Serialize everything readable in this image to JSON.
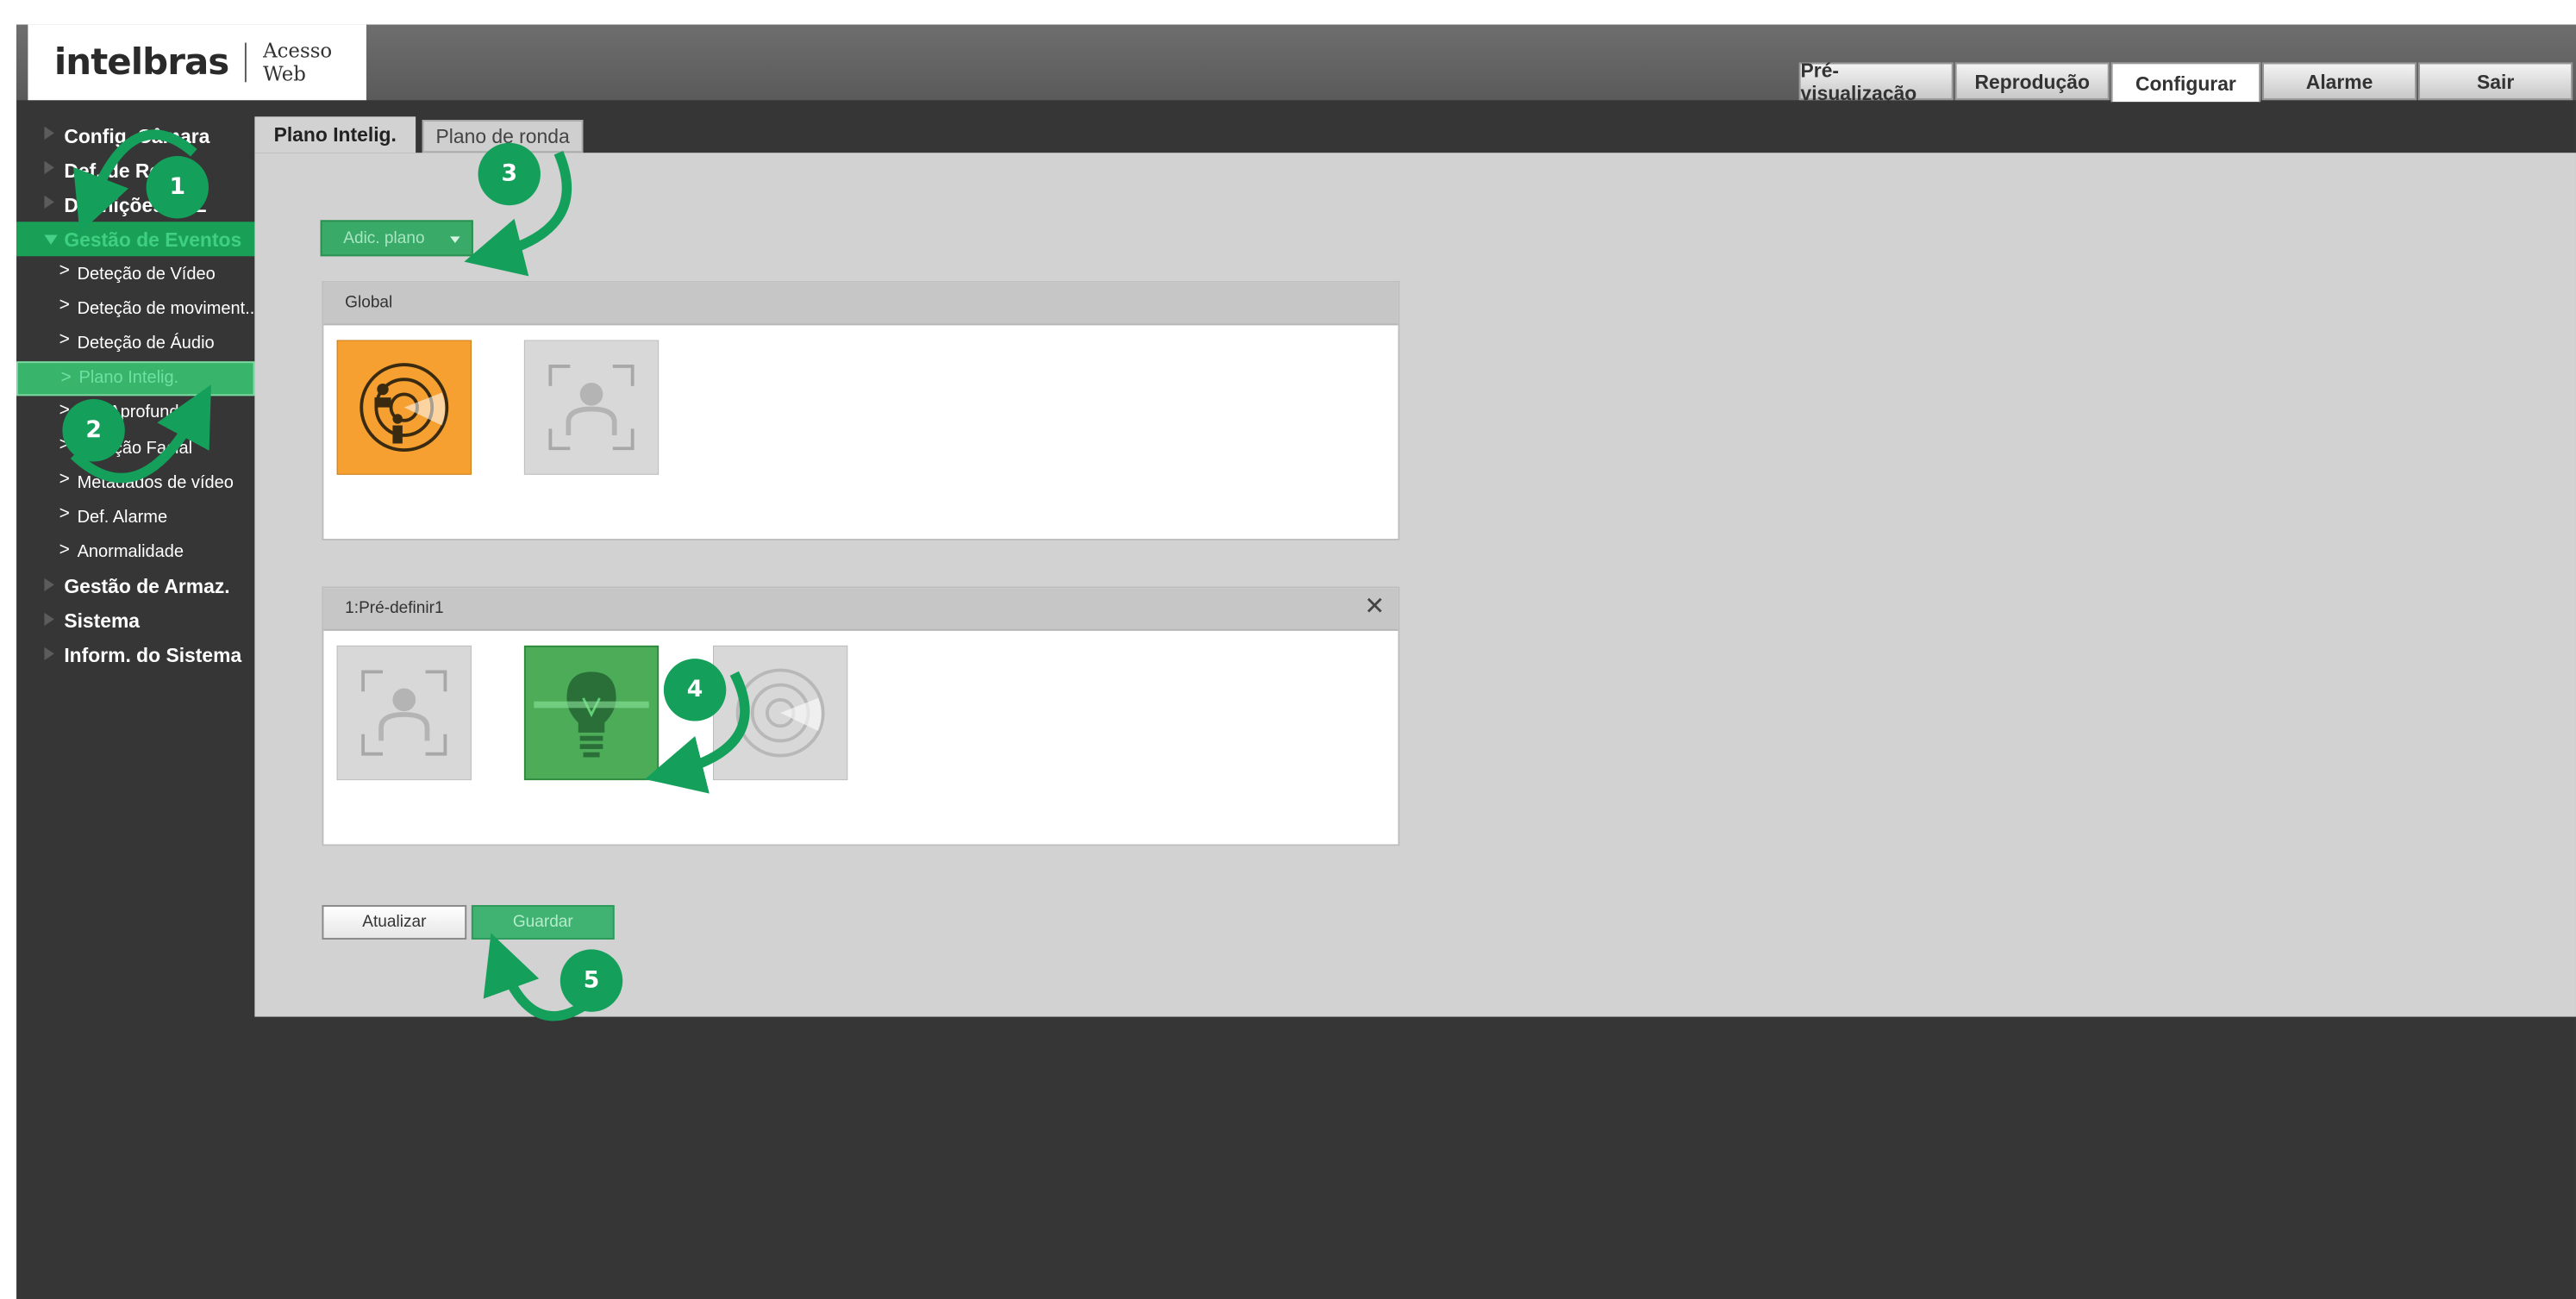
{
  "header": {
    "brand": "intelbras",
    "subtitle": "Acesso Web",
    "nav": [
      {
        "label": "Pré-visualização",
        "active": false
      },
      {
        "label": "Reprodução",
        "active": false
      },
      {
        "label": "Configurar",
        "active": true
      },
      {
        "label": "Alarme",
        "active": false
      },
      {
        "label": "Sair",
        "active": false
      }
    ]
  },
  "sidebar": {
    "sections": [
      {
        "label": "Config. Câmara"
      },
      {
        "label": "Def. de Rede"
      },
      {
        "label": "Definições PTZ"
      },
      {
        "label": "Gestão de Eventos",
        "open": true
      },
      {
        "label": "Gestão de Armaz."
      },
      {
        "label": "Sistema"
      },
      {
        "label": "Inform. do Sistema"
      }
    ],
    "event_items": [
      {
        "label": "Deteção de Vídeo"
      },
      {
        "label": "Deteção de moviment..."
      },
      {
        "label": "Deteção de Áudio"
      },
      {
        "label": "Plano Intelig.",
        "active": true
      },
      {
        "label": "IVS Aprofundado"
      },
      {
        "label": "Deteção Facial"
      },
      {
        "label": "Metadados de vídeo"
      },
      {
        "label": "Def. Alarme"
      },
      {
        "label": "Anormalidade"
      }
    ]
  },
  "tabs": [
    {
      "label": "Plano Intelig.",
      "active": true
    },
    {
      "label": "Plano de ronda",
      "active": false
    }
  ],
  "content": {
    "add_plan_label": "Adic. plano",
    "global_panel": {
      "title": "Global",
      "tiles": [
        "ivs-radar-icon",
        "face-detection-icon"
      ]
    },
    "preset_panel": {
      "title": "1:Pré-definir1",
      "tiles": [
        "face-detection-icon",
        "light-bulb-icon",
        "ivs-radar-icon"
      ]
    },
    "refresh_label": "Atualizar",
    "save_label": "Guardar"
  },
  "annotations": {
    "steps": [
      "1",
      "2",
      "3",
      "4",
      "5"
    ],
    "accent_color": "#14a05a"
  },
  "colors": {
    "header_gray": "#5a5a5a",
    "sidebar_dark": "#363636",
    "active_green": "#38b56a",
    "orange_tile": "#f5a030",
    "green_tile": "#4cac58"
  }
}
